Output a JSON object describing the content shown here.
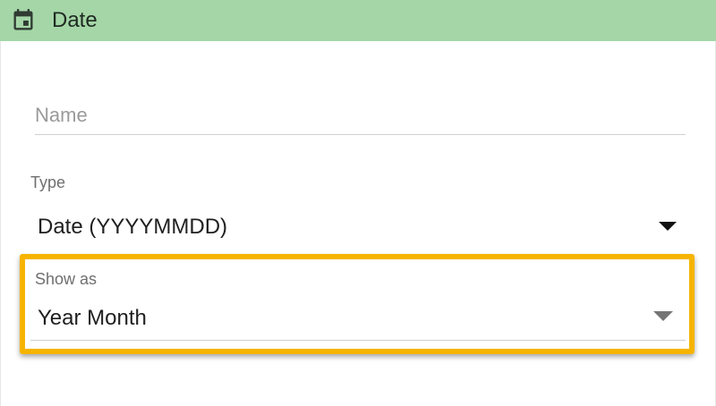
{
  "header": {
    "icon": "calendar-icon",
    "title": "Date",
    "background": "#a5d6a7"
  },
  "form": {
    "name": {
      "placeholder": "Name",
      "value": ""
    },
    "type": {
      "label": "Type",
      "value": "Date (YYYYMMDD)"
    },
    "show_as": {
      "label": "Show as",
      "value": "Year Month",
      "highlighted": true,
      "highlight_color": "#f6b400"
    }
  }
}
